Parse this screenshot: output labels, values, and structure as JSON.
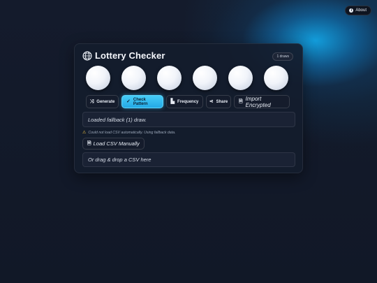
{
  "about": {
    "icon": "info-icon",
    "label": "About"
  },
  "header": {
    "title": "Lottery Checker",
    "icon": "globe-icon",
    "draws_badge": "1 draws"
  },
  "balls": [
    "",
    "",
    "",
    "",
    "",
    ""
  ],
  "actions": [
    {
      "name": "generate",
      "label": "Generate",
      "icon": "shuffle-icon",
      "glyph": "⤨",
      "active": false
    },
    {
      "name": "check-pattern",
      "label": "Check Pattern",
      "icon": "check-icon",
      "glyph": "✓",
      "active": true
    },
    {
      "name": "frequency",
      "label": "Frequency",
      "icon": "bar-chart-icon",
      "glyph": "▙",
      "active": false
    },
    {
      "name": "share",
      "label": "Share",
      "icon": "share-icon",
      "glyph": "⋖",
      "active": false
    },
    {
      "name": "import-encrypted",
      "label": "Import Encrypted",
      "icon": "file-icon",
      "glyph": "🗎",
      "active": false
    }
  ],
  "status": {
    "text": "Loaded fallback (1) draw."
  },
  "warning": {
    "icon": "warning-icon",
    "text": "Could not load CSV automatically. Using fallback data."
  },
  "load_csv": {
    "icon": "file-icon",
    "label": "Load CSV Manually"
  },
  "drop_zone": {
    "text": "Or drag & drop a CSV here"
  },
  "colors": {
    "accent": "#2bb3ec",
    "background": "#121a2b",
    "card": "#141c2d"
  }
}
